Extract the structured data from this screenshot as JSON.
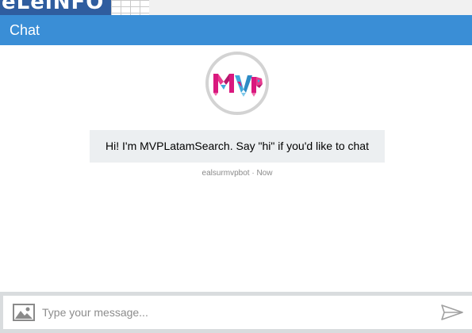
{
  "background": {
    "logo_text": "eLeiNFO"
  },
  "header": {
    "title": "Chat"
  },
  "bot": {
    "avatar_text": "MVP",
    "message": "Hi! I'm MVPLatamSearch. Say \"hi\" if you'd like to chat",
    "sender": "ealsurmvpbot",
    "separator": " · ",
    "time": "Now"
  },
  "composer": {
    "placeholder": "Type your message...",
    "image_icon": "image-icon",
    "send_icon": "send-icon"
  },
  "colors": {
    "header": "#3a8ed6",
    "bubble": "#eceff1",
    "avatar_pink": "#d9187e",
    "avatar_blue": "#3fa9dc"
  }
}
